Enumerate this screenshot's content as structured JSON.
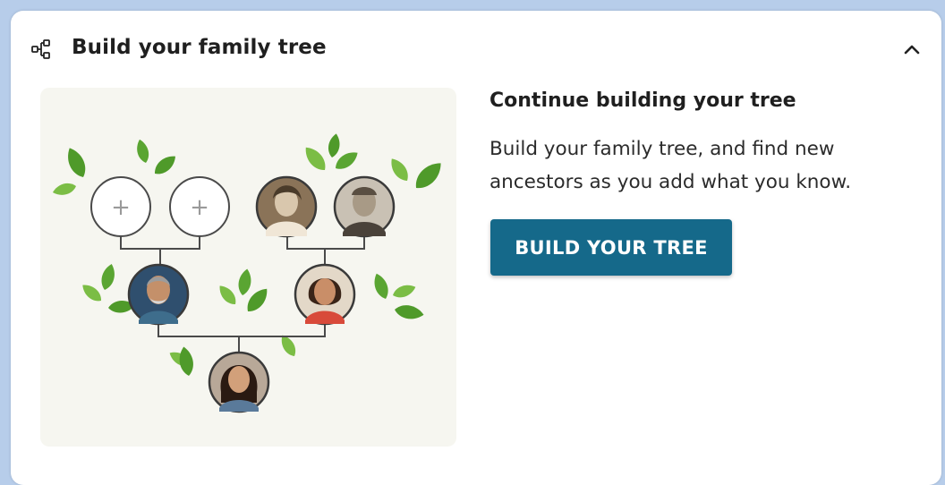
{
  "header": {
    "title": "Build your family tree",
    "icon": "tree-diagram-icon",
    "collapse_icon": "chevron-up-icon"
  },
  "cta": {
    "heading": "Continue building your tree",
    "body": "Build your family tree, and find new ancestors as you add what you know.",
    "button_label": "BUILD YOUR TREE"
  },
  "illustration": {
    "empty_slot_symbol": "+",
    "people": [
      "grandmother-photo",
      "grandfather-photo",
      "father-photo",
      "mother-photo",
      "child-photo"
    ]
  },
  "colors": {
    "background": "#b7cdea",
    "button": "#15698a",
    "leaf": "#6fae3a",
    "leaf_dark": "#4f9a2a",
    "illustration_bg": "#f6f6f0"
  }
}
